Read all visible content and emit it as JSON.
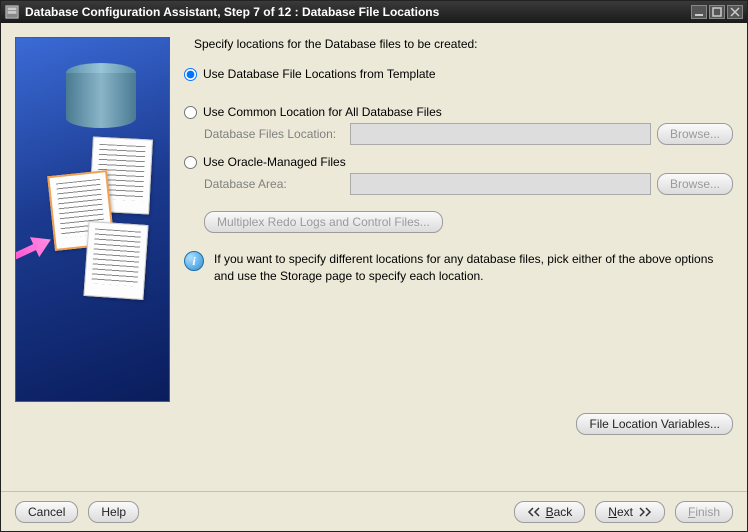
{
  "window": {
    "title": "Database Configuration Assistant, Step 7 of 12 : Database File Locations"
  },
  "main": {
    "instruction": "Specify locations for the Database files to be created:",
    "opt1": "Use Database File Locations from Template",
    "opt2": "Use Common Location for All Database Files",
    "opt2_field_label": "Database Files Location:",
    "opt2_field_value": "",
    "opt2_browse": "Browse...",
    "opt3": "Use Oracle-Managed Files",
    "opt3_field_label": "Database Area:",
    "opt3_field_value": "",
    "opt3_browse": "Browse...",
    "multiplex": "Multiplex Redo Logs and Control Files...",
    "info": "If you want to specify different locations for any database files, pick either of the above options and use the Storage page to specify each location.",
    "file_loc_vars": "File Location Variables..."
  },
  "footer": {
    "cancel": "Cancel",
    "help": "Help",
    "back": "Back",
    "next": "Next",
    "finish": "Finish"
  }
}
